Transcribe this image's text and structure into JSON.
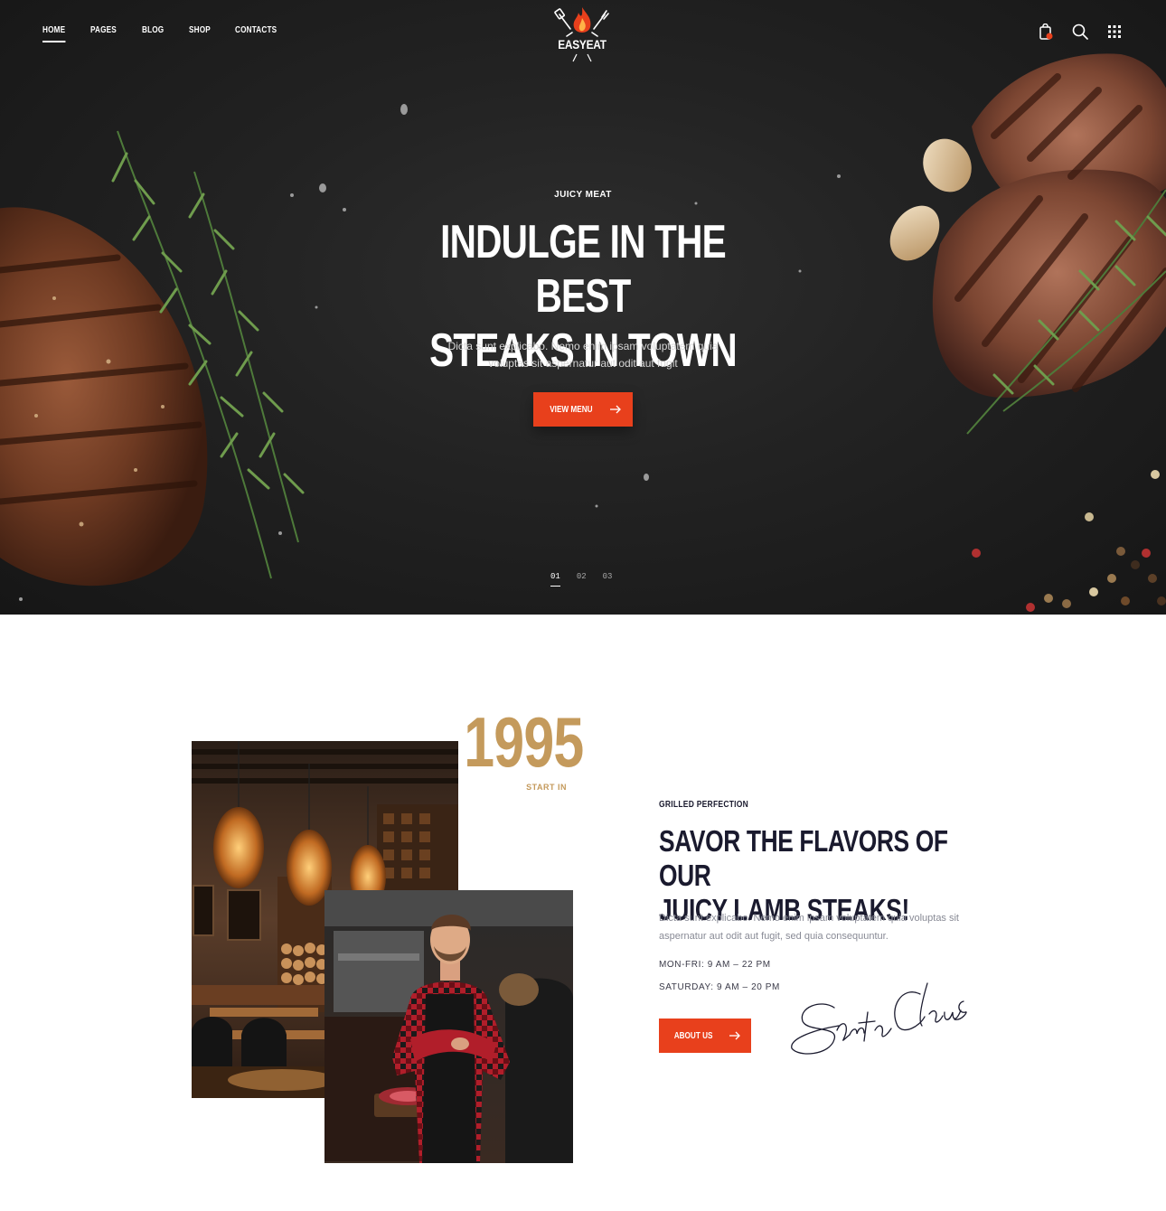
{
  "nav": {
    "items": [
      {
        "label": "HOME",
        "active": true
      },
      {
        "label": "PAGES",
        "active": false
      },
      {
        "label": "BLOG",
        "active": false
      },
      {
        "label": "SHOP",
        "active": false
      },
      {
        "label": "CONTACTS",
        "active": false
      }
    ],
    "logo_text": "EASYEAT",
    "icons": [
      "cart-icon",
      "search-icon",
      "grid-menu-icon"
    ]
  },
  "hero": {
    "eyebrow": "JUICY MEAT",
    "title_line1": "INDULGE IN THE BEST",
    "title_line2": "STEAKS IN TOWN",
    "subtitle_line1": "Dicta sunt explicabo. Nemo enim ipsam voluptatem quia",
    "subtitle_line2": "voluptas sit aspernatur aut odit aut fugit",
    "button_label": "VIEW MENU",
    "slides": [
      "01",
      "02",
      "03"
    ],
    "active_slide": 0
  },
  "about": {
    "year": "1995",
    "year_caption": "START IN",
    "eyebrow": "GRILLED PERFECTION",
    "title_line1": "SAVOR THE FLAVORS OF OUR",
    "title_line2": "JUICY LAMB STEAKS!",
    "description": "Dicta sunt explicabo. Nemo enim ipsam voluptatem quia voluptas sit aspernatur aut odit aut fugit, sed quia consequuntur.",
    "hours_weekday": "MON-FRI: 9 AM – 22 PM",
    "hours_saturday": "SATURDAY: 9 AM – 20 PM",
    "button_label": "ABOUT US",
    "signature": "Santa Claus"
  },
  "colors": {
    "accent": "#e8401c",
    "gold": "#c49a5c",
    "dark_text": "#1a1a2e",
    "hero_bg": "#232323"
  }
}
